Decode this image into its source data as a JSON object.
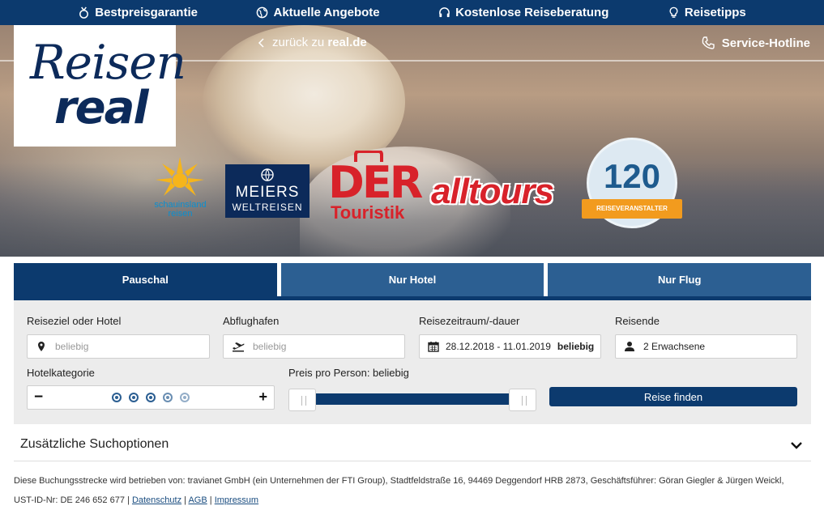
{
  "topbar": {
    "items": [
      {
        "label": "Bestpreisgarantie",
        "icon": "medal-icon"
      },
      {
        "label": "Aktuelle Angebote",
        "icon": "globe-icon"
      },
      {
        "label": "Kostenlose Reiseberatung",
        "icon": "headset-icon"
      },
      {
        "label": "Reisetipps",
        "icon": "lightbulb-icon"
      }
    ]
  },
  "header": {
    "logo_line1": "Reisen",
    "logo_line2": "real",
    "back_prefix": "zurück zu",
    "back_site": "real.de",
    "hotline": "Service-Hotline"
  },
  "partners": {
    "schauinsland": "schauinsland reisen",
    "meiers_line1": "MEIERS",
    "meiers_line2": "WELTREISEN",
    "der_line1": "DER",
    "der_line2": "Touristik",
    "alltours": "alltours",
    "badge_number": "120",
    "badge_text": "REISEVERANSTALTER"
  },
  "search": {
    "tabs": [
      {
        "label": "Pauschal",
        "active": true
      },
      {
        "label": "Nur Hotel",
        "active": false
      },
      {
        "label": "Nur Flug",
        "active": false
      }
    ],
    "destination": {
      "label": "Reiseziel oder Hotel",
      "placeholder": "beliebig"
    },
    "airport": {
      "label": "Abflughafen",
      "placeholder": "beliebig"
    },
    "period": {
      "label": "Reisezeitraum/-dauer",
      "dates": "28.12.2018 - 11.01.2019",
      "duration": "beliebig"
    },
    "travellers": {
      "label": "Reisende",
      "value": "2 Erwachsene"
    },
    "hotel_category": {
      "label": "Hotelkategorie",
      "minus": "−",
      "plus": "+"
    },
    "price": {
      "label": "Preis pro Person: beliebig"
    },
    "submit": "Reise finden"
  },
  "extra_options": {
    "title": "Zusätzliche Suchoptionen"
  },
  "footer": {
    "line1": "Diese Buchungsstrecke wird betrieben von: travianet GmbH (ein Unternehmen der FTI Group), Stadtfeldstraße 16, 94469 Deggendorf HRB 2873, Geschäftsführer: Göran Giegler & Jürgen Weickl,",
    "vat": "UST-ID-Nr: DE 246 652 677 |",
    "links": [
      "Datenschutz",
      "AGB",
      "Impressum"
    ],
    "separator": "|"
  },
  "colors": {
    "brand_navy": "#0c3a6e",
    "tab_inactive": "#2c5f92",
    "partner_red": "#d8222a",
    "badge_orange": "#f29b1e"
  }
}
